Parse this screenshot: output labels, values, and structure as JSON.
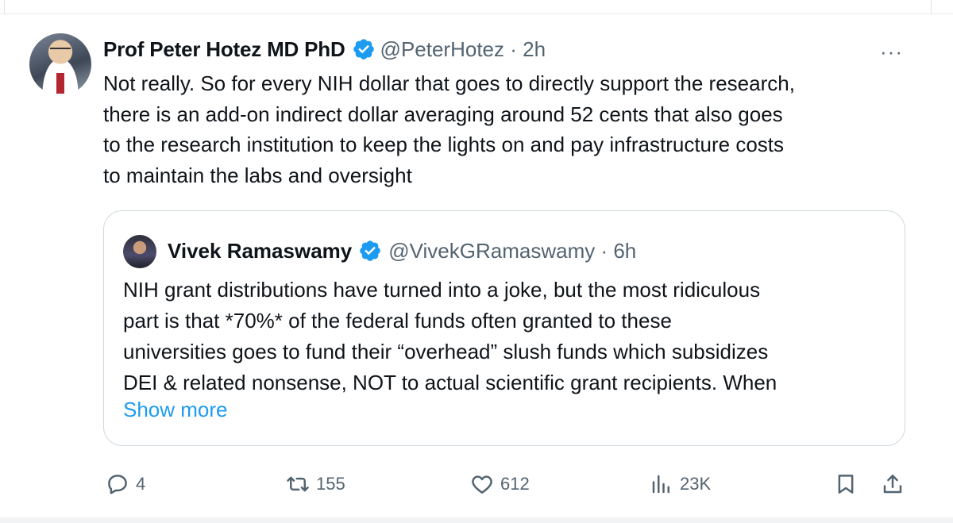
{
  "tweet": {
    "author_name": "Prof Peter Hotez MD PhD",
    "handle_time": "@PeterHotez · 2h",
    "more_label": "···",
    "text": "Not really. So for every NIH dollar that goes to directly support the research,\nthere is an add-on indirect dollar averaging around 52 cents that also goes\nto the research institution to keep the lights on and pay infrastructure costs\nto maintain the labs and oversight"
  },
  "quoted": {
    "author_name": "Vivek Ramaswamy",
    "handle_time": "@VivekGRamaswamy · 6h",
    "text": "NIH grant distributions have turned into a joke, but the most ridiculous\npart is that *70%* of the federal funds often granted to these\nuniversities goes to fund their “overhead” slush funds which subsidizes\nDEI & related nonsense, NOT to actual scientific grant recipients. When",
    "show_more": "Show more"
  },
  "actions": {
    "replies": "4",
    "reposts": "155",
    "likes": "612",
    "views": "23K"
  },
  "icons": {
    "verified": "verified-badge-icon",
    "reply": "reply-icon",
    "repost": "repost-icon",
    "like": "heart-icon",
    "views": "views-chart-icon",
    "bookmark": "bookmark-icon",
    "share": "share-icon"
  },
  "colors": {
    "accent": "#1d9bf0",
    "muted": "#536471",
    "text": "#0f1419",
    "border": "#cfd9de"
  }
}
